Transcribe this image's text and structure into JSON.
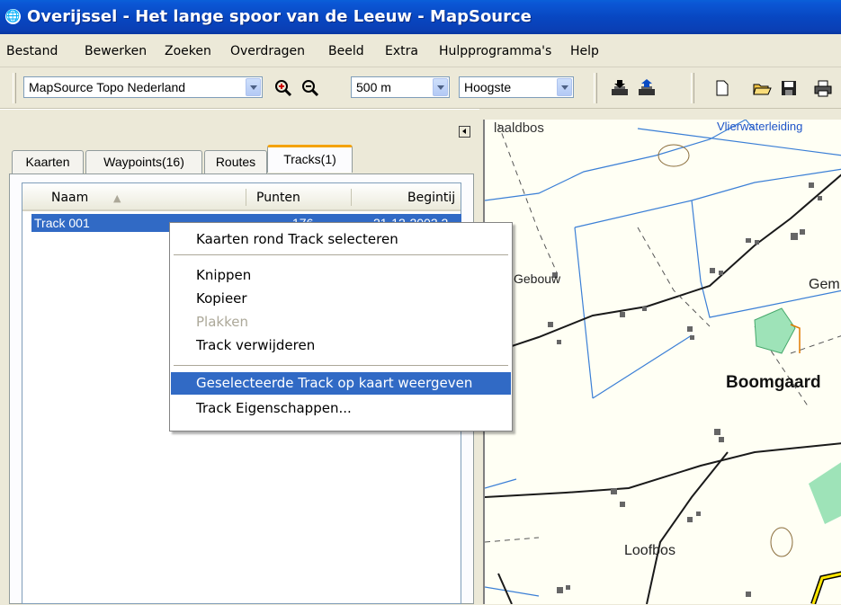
{
  "window": {
    "title": "Overijssel - Het lange spoor van de Leeuw - MapSource"
  },
  "menu": [
    "Bestand",
    "Bewerken",
    "Zoeken",
    "Overdragen",
    "Beeld",
    "Extra",
    "Hulpprogramma's",
    "Help"
  ],
  "toolbar": {
    "map_product": "MapSource Topo Nederland",
    "scale": "500 m",
    "detail": "Hoogste",
    "icons": [
      "zoom-in-icon",
      "zoom-out-icon",
      "receive-from-device-icon",
      "send-to-device-icon",
      "new-file-icon",
      "open-file-icon",
      "save-icon",
      "print-icon"
    ]
  },
  "tabs": [
    {
      "label": "Kaarten",
      "active": false
    },
    {
      "label": "Waypoints(16)",
      "active": false
    },
    {
      "label": "Routes",
      "active": false
    },
    {
      "label": "Tracks(1)",
      "active": true
    }
  ],
  "track_list": {
    "columns": [
      "Naam",
      "Punten",
      "Begintij"
    ],
    "rows": [
      {
        "name": "Track 001",
        "points": "176",
        "start": "21-12-2003 2"
      }
    ]
  },
  "context_menu": {
    "items": [
      {
        "label": "Kaarten rond Track selecteren",
        "state": "normal"
      },
      {
        "label": "Knippen",
        "state": "normal"
      },
      {
        "label": "Kopieer",
        "state": "normal"
      },
      {
        "label": "Plakken",
        "state": "disabled"
      },
      {
        "label": "Track verwijderen",
        "state": "normal"
      },
      {
        "label": "Geselecteerde Track op kaart weergeven",
        "state": "highlighted"
      },
      {
        "label": "Track Eigenschappen...",
        "state": "normal"
      }
    ]
  },
  "map": {
    "labels": {
      "north_west": "laaldbos",
      "north": "Vlierwaterleiding",
      "building": "Gebouw",
      "east": "Gem",
      "place": "Boomgaard",
      "south": "Loofbos"
    },
    "colors": {
      "background": "#fffff4",
      "water": "#3b7fd6",
      "road": "#1a1a1a",
      "park": "#9ee3b8",
      "track": "#ffe600"
    }
  }
}
